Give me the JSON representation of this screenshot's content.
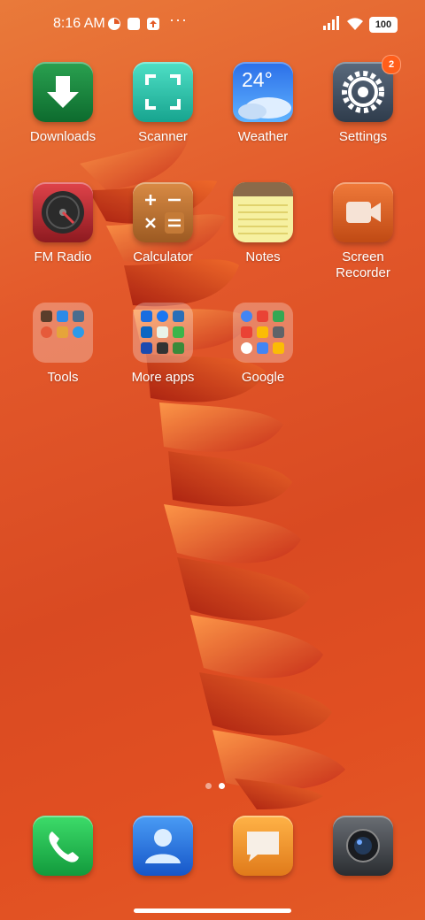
{
  "status": {
    "time": "8:16 AM",
    "battery": "100",
    "more": "···"
  },
  "apps": {
    "downloads": "Downloads",
    "scanner": "Scanner",
    "weather": "Weather",
    "weather_temp": "24°",
    "settings": "Settings",
    "settings_badge": "2",
    "fm_radio": "FM Radio",
    "calculator": "Calculator",
    "notes": "Notes",
    "screen_recorder": "Screen Recorder"
  },
  "folders": {
    "tools": "Tools",
    "more_apps": "More apps",
    "google": "Google"
  },
  "pages": {
    "count": 2,
    "active": 2
  },
  "colors": {
    "wallpaper": "#e3592b",
    "badge": "#ff5e1a"
  }
}
